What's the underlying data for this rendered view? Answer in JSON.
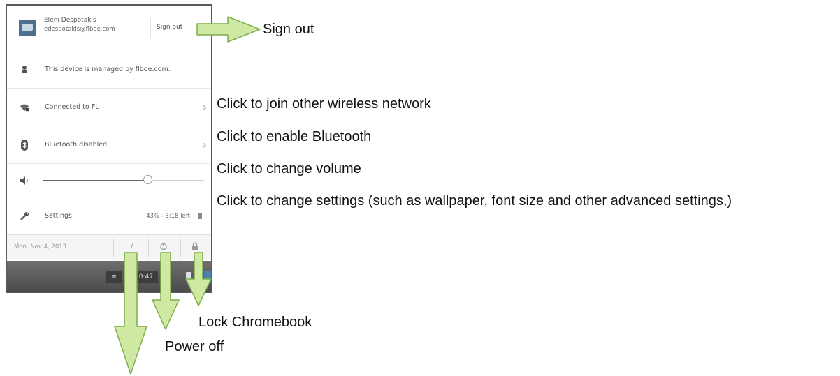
{
  "tray": {
    "user": {
      "name": "Eleni Despotakis",
      "email": "edespotakis@flboe.com",
      "sign_out_label": "Sign out"
    },
    "managed_text": "This device is managed by flboe.com.",
    "wifi_label": "Connected to FL",
    "bluetooth_label": "Bluetooth disabled",
    "volume_level": 0.65,
    "settings_label": "Settings",
    "battery_text": "43% - 3:18 left",
    "footer": {
      "date": "Mon, Nov 4, 2013",
      "help_label": "?",
      "power_glyph": "⏻",
      "lock_glyph": "🔒"
    },
    "shelf": {
      "left_icon": "≡",
      "clock": "10:47"
    }
  },
  "annotations": {
    "sign_out": "Sign out",
    "wifi": "Click to join other wireless network",
    "bluetooth": "Click to enable Bluetooth",
    "volume": "Click to change volume",
    "settings": "Click to change settings (such as wallpaper,  font size and other advanced settings,)",
    "lock": "Lock Chromebook",
    "power": "Power off"
  },
  "colors": {
    "arrow_fill": "#cfe8a2",
    "arrow_stroke": "#7fae4f",
    "avatar": "#4e6f8f"
  },
  "icons": {
    "managed": "managed-device-icon",
    "wifi": "wifi-icon",
    "bluetooth": "bluetooth-icon",
    "volume": "speaker-icon",
    "settings": "wrench-icon",
    "battery": "battery-icon",
    "power": "power-icon",
    "lock": "lock-icon",
    "help": "help-icon"
  }
}
